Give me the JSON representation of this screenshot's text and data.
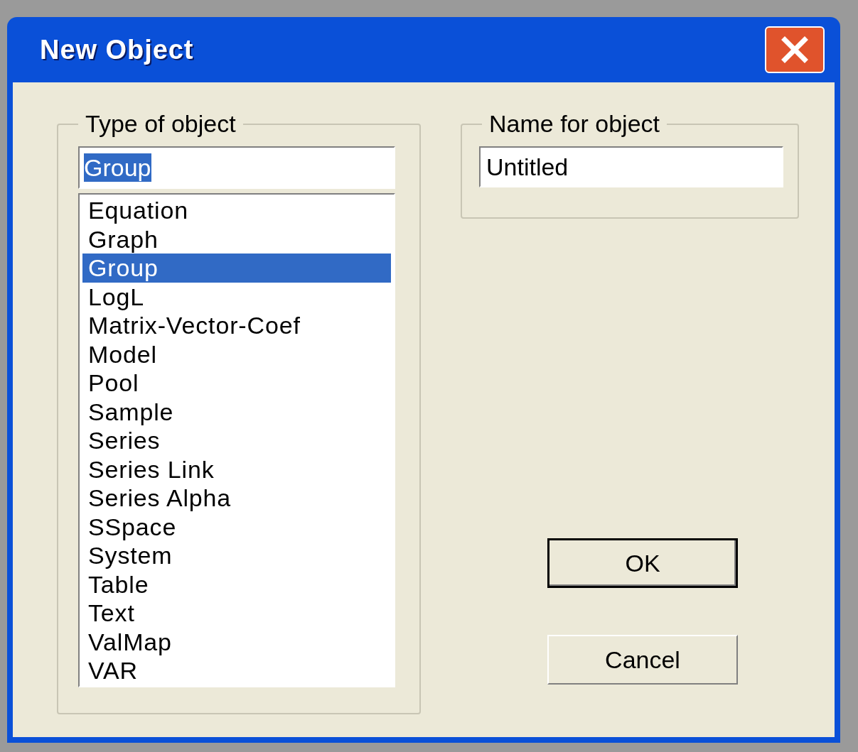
{
  "window": {
    "title": "New Object"
  },
  "type_group": {
    "label": "Type of object",
    "field": {
      "value": "Group",
      "text_selected": true
    },
    "items": [
      {
        "label": "Equation",
        "selected": false
      },
      {
        "label": "Graph",
        "selected": false
      },
      {
        "label": "Group",
        "selected": true
      },
      {
        "label": "LogL",
        "selected": false
      },
      {
        "label": "Matrix-Vector-Coef",
        "selected": false
      },
      {
        "label": "Model",
        "selected": false
      },
      {
        "label": "Pool",
        "selected": false
      },
      {
        "label": "Sample",
        "selected": false
      },
      {
        "label": "Series",
        "selected": false
      },
      {
        "label": "Series Link",
        "selected": false
      },
      {
        "label": "Series Alpha",
        "selected": false
      },
      {
        "label": "SSpace",
        "selected": false
      },
      {
        "label": "System",
        "selected": false
      },
      {
        "label": "Table",
        "selected": false
      },
      {
        "label": "Text",
        "selected": false
      },
      {
        "label": "ValMap",
        "selected": false
      },
      {
        "label": "VAR",
        "selected": false
      }
    ]
  },
  "name_group": {
    "label": "Name for object",
    "field": {
      "value": "Untitled"
    }
  },
  "buttons": [
    {
      "label": "OK",
      "default": true
    },
    {
      "label": "Cancel",
      "default": false
    }
  ]
}
